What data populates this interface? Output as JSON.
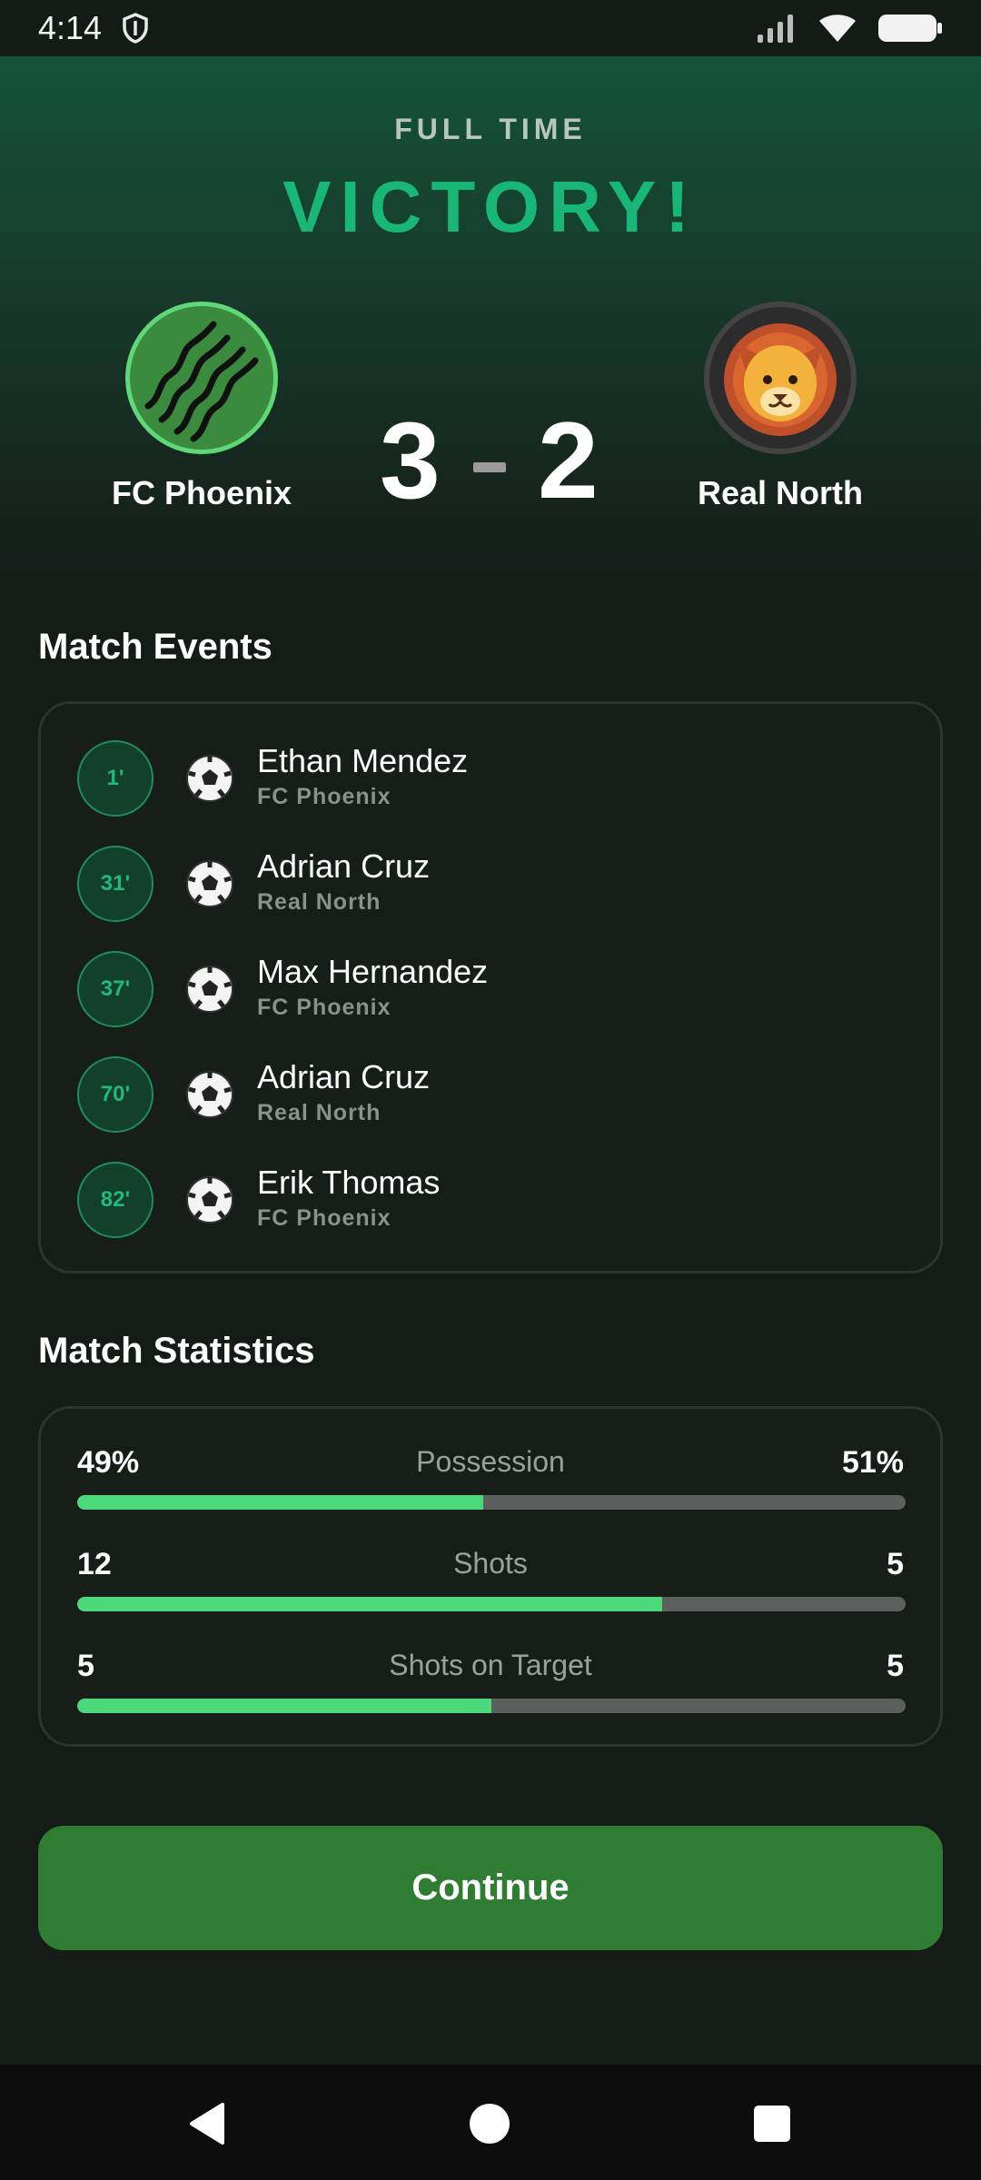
{
  "status_bar": {
    "time": "4:14",
    "icons": [
      "shield-icon",
      "signal-icon",
      "wifi-icon",
      "battery-icon"
    ]
  },
  "match": {
    "status": "FULL TIME",
    "result": "VICTORY!",
    "home": {
      "name": "FC Phoenix",
      "score": "3",
      "badge": "stripes-badge-icon"
    },
    "away": {
      "name": "Real North",
      "score": "2",
      "badge": "lion-icon"
    }
  },
  "events": {
    "title": "Match Events",
    "items": [
      {
        "minute": "1'",
        "player": "Ethan Mendez",
        "team": "FC Phoenix",
        "icon": "soccer-ball-icon"
      },
      {
        "minute": "31'",
        "player": "Adrian Cruz",
        "team": "Real North",
        "icon": "soccer-ball-icon"
      },
      {
        "minute": "37'",
        "player": "Max Hernandez",
        "team": "FC Phoenix",
        "icon": "soccer-ball-icon"
      },
      {
        "minute": "70'",
        "player": "Adrian Cruz",
        "team": "Real North",
        "icon": "soccer-ball-icon"
      },
      {
        "minute": "82'",
        "player": "Erik Thomas",
        "team": "FC Phoenix",
        "icon": "soccer-ball-icon"
      }
    ]
  },
  "statistics": {
    "title": "Match Statistics",
    "items": [
      {
        "label": "Possession",
        "home": "49%",
        "away": "51%",
        "home_fraction": 0.49
      },
      {
        "label": "Shots",
        "home": "12",
        "away": "5",
        "home_fraction": 0.706
      },
      {
        "label": "Shots on Target",
        "home": "5",
        "away": "5",
        "home_fraction": 0.5
      }
    ]
  },
  "actions": {
    "continue_label": "Continue"
  },
  "colors": {
    "accent": "#19b777",
    "bar_fill": "#4cd97a",
    "bar_track": "#5c5f5d",
    "button": "#2e7d32"
  },
  "navigation": {
    "buttons": [
      "back-icon",
      "home-icon",
      "recents-icon"
    ]
  }
}
